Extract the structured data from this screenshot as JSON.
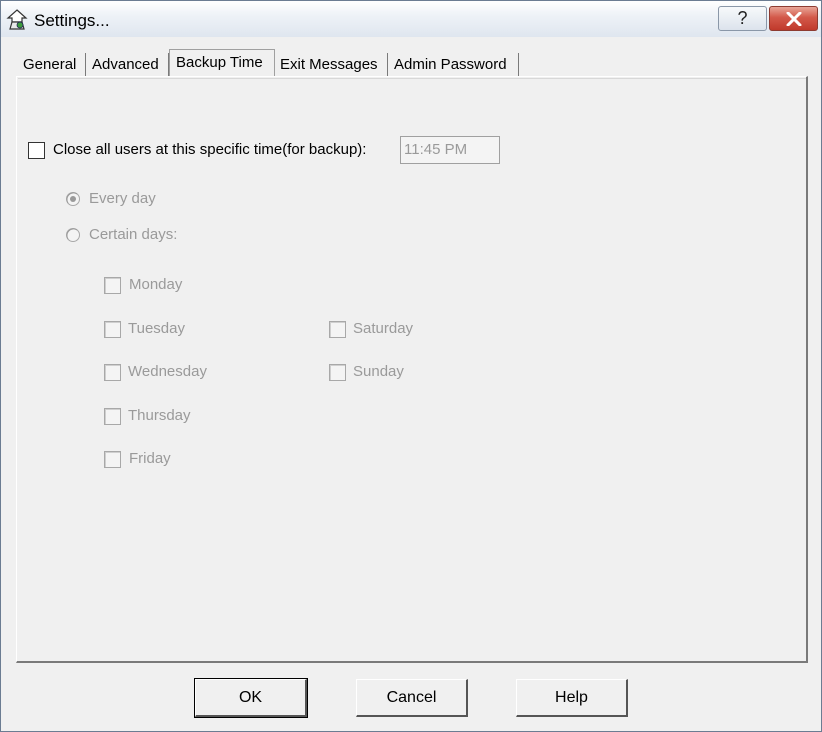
{
  "window": {
    "title": "Settings..."
  },
  "titlebar": {
    "help_label": "?",
    "close_icon": "close-icon"
  },
  "tabs": [
    {
      "label": "General",
      "active": false
    },
    {
      "label": "Advanced",
      "active": false
    },
    {
      "label": "Backup Time",
      "active": true
    },
    {
      "label": "Exit Messages",
      "active": false
    },
    {
      "label": "Admin Password",
      "active": false
    }
  ],
  "backup": {
    "close_all_label": "Close all users at this specific time(for backup):",
    "close_all_checked": false,
    "time_value": "11:45 PM",
    "every_day_label": "Every day",
    "every_day_selected": true,
    "certain_days_label": "Certain days:",
    "days": {
      "monday": "Monday",
      "tuesday": "Tuesday",
      "wednesday": "Wednesday",
      "thursday": "Thursday",
      "friday": "Friday",
      "saturday": "Saturday",
      "sunday": "Sunday"
    }
  },
  "buttons": {
    "ok": "OK",
    "cancel": "Cancel",
    "help": "Help"
  }
}
